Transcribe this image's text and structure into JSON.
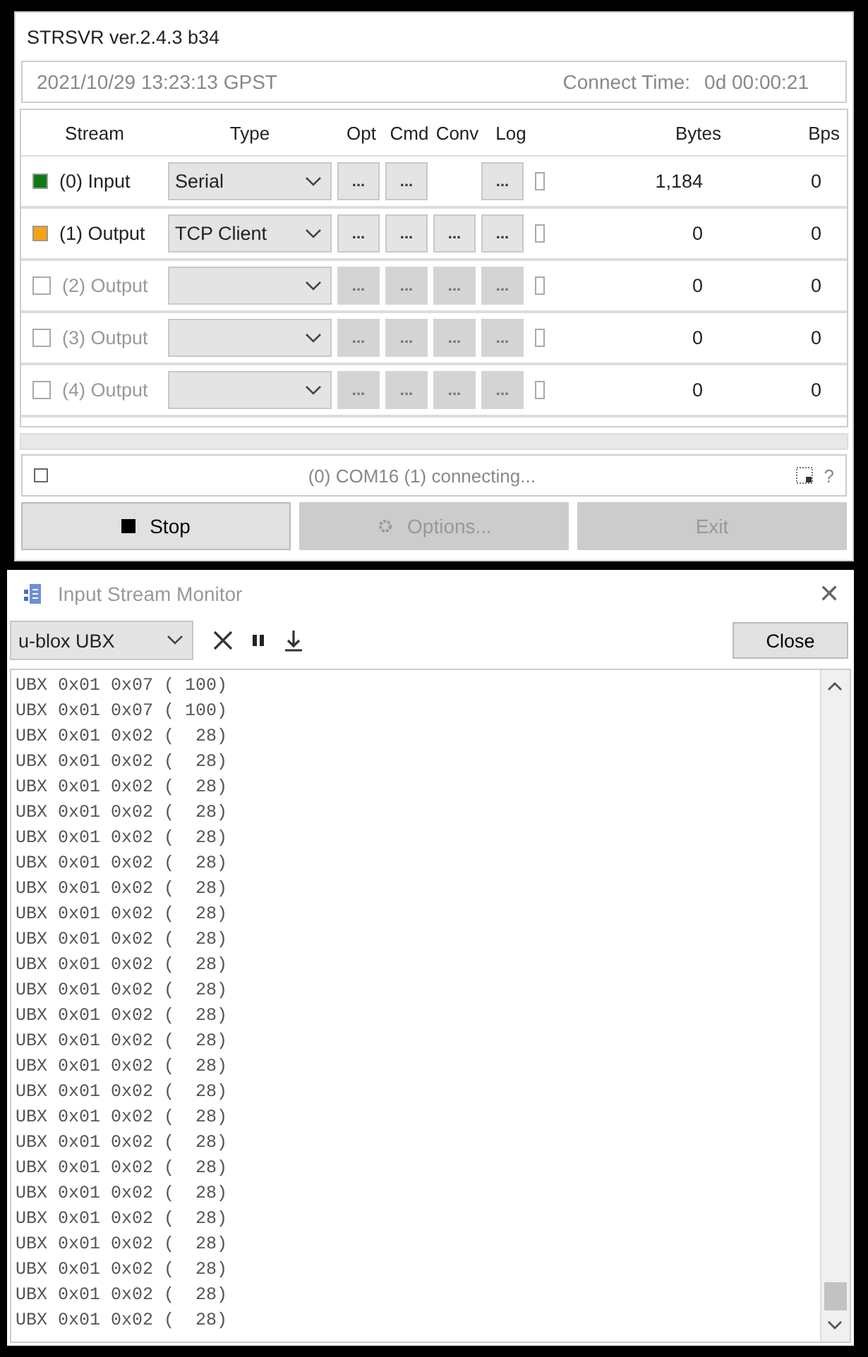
{
  "server": {
    "title": "STRSVR ver.2.4.3 b34",
    "time": "2021/10/29 13:23:13 GPST",
    "connect_label": "Connect Time:",
    "connect_time": "0d 00:00:21",
    "columns": [
      "Stream",
      "Type",
      "Opt",
      "Cmd",
      "Conv",
      "Log",
      "Bytes",
      "Bps"
    ],
    "streams": [
      {
        "label": "(0) Input",
        "type": "Serial",
        "enabled": true,
        "color": "#0f7a12",
        "conv": false,
        "log": false,
        "bytes": "1,184",
        "bps": "0"
      },
      {
        "label": "(1) Output",
        "type": "TCP Client",
        "enabled": true,
        "color": "#f5a316",
        "conv": true,
        "log": false,
        "bytes": "0",
        "bps": "0"
      },
      {
        "label": "(2) Output",
        "enabled": false,
        "checked": false,
        "conv": true,
        "log": false,
        "bytes": "0",
        "bps": "0"
      },
      {
        "label": "(3) Output",
        "enabled": false,
        "checked": false,
        "conv": true,
        "log": false,
        "bytes": "0",
        "bps": "0"
      },
      {
        "label": "(4) Output",
        "enabled": false,
        "checked": false,
        "conv": true,
        "log": false,
        "bytes": "0",
        "bps": "0"
      }
    ],
    "status_checked": false,
    "dots": "...",
    "status": "(0) COM16 (1) connecting...",
    "help": "?",
    "buttons": [
      {
        "label": "Stop",
        "kind": "stop",
        "disabled": false
      },
      {
        "label": "Options...",
        "kind": "options",
        "disabled": true
      },
      {
        "label": "Exit",
        "kind": "plain",
        "disabled": true
      }
    ]
  },
  "monitor": {
    "title": "Input Stream Monitor",
    "close_glyph": "✕",
    "format": "u-blox UBX",
    "close_button": "Close",
    "lines": [
      "UBX 0x01 0x07 ( 100)",
      "UBX 0x01 0x07 ( 100)",
      "UBX 0x01 0x02 (  28)",
      "UBX 0x01 0x02 (  28)",
      "UBX 0x01 0x02 (  28)",
      "UBX 0x01 0x02 (  28)",
      "UBX 0x01 0x02 (  28)",
      "UBX 0x01 0x02 (  28)",
      "UBX 0x01 0x02 (  28)",
      "UBX 0x01 0x02 (  28)",
      "UBX 0x01 0x02 (  28)",
      "UBX 0x01 0x02 (  28)",
      "UBX 0x01 0x02 (  28)",
      "UBX 0x01 0x02 (  28)",
      "UBX 0x01 0x02 (  28)",
      "UBX 0x01 0x02 (  28)",
      "UBX 0x01 0x02 (  28)",
      "UBX 0x01 0x02 (  28)",
      "UBX 0x01 0x02 (  28)",
      "UBX 0x01 0x02 (  28)",
      "UBX 0x01 0x02 (  28)",
      "UBX 0x01 0x02 (  28)",
      "UBX 0x01 0x02 (  28)",
      "UBX 0x01 0x02 (  28)",
      "UBX 0x01 0x02 (  28)",
      "UBX 0x01 0x02 (  28)"
    ]
  }
}
